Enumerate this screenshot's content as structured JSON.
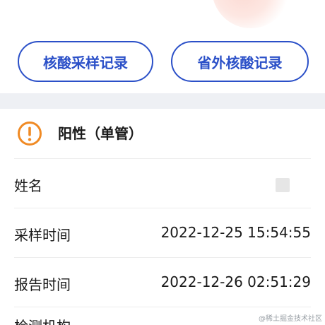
{
  "actions": {
    "left_button": "核酸采样记录",
    "right_button": "省外核酸记录"
  },
  "colors": {
    "accent": "#2b50c8",
    "warning": "#f08a24",
    "divider": "#ececec",
    "section_gap": "#eef0f4"
  },
  "status": {
    "icon": "warning-circle-icon",
    "text": "阳性（单管）"
  },
  "details": {
    "name_label": "姓名",
    "sample_time_label": "采样时间",
    "sample_time_value": "2022-12-25 15:54:55",
    "report_time_label": "报告时间",
    "report_time_value": "2022-12-26 02:51:29",
    "next_row_label": "检测机构"
  },
  "watermark": "@稀土掘金技术社区"
}
